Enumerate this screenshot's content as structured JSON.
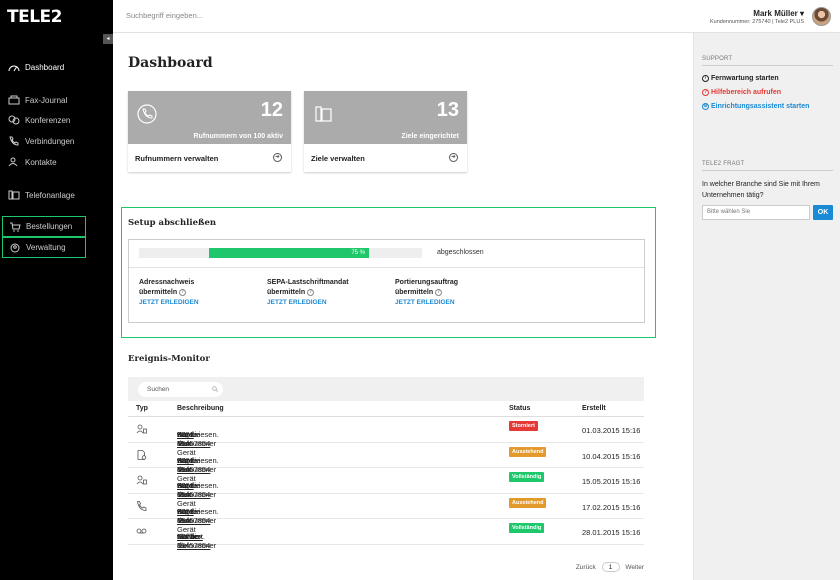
{
  "brand": {
    "logo": "TELE2"
  },
  "search": {
    "placeholder": "Suchbegriff eingeben..."
  },
  "user": {
    "name": "Mark Müller ▾",
    "sub": "Kundennummer: 275740 | Tele2 PLUS"
  },
  "sidebar": {
    "collapse_glyph": "◂",
    "items": [
      {
        "label": "Dashboard",
        "icon": "gauge-icon"
      },
      {
        "label": "Fax-Journal",
        "icon": "fax-icon"
      },
      {
        "label": "Konferenzen",
        "icon": "conference-icon"
      },
      {
        "label": "Verbindungen",
        "icon": "phone-icon"
      },
      {
        "label": "Kontakte",
        "icon": "contacts-icon"
      },
      {
        "label": "Telefonanlage",
        "icon": "phone-system-icon"
      },
      {
        "label": "Bestellungen",
        "icon": "cart-icon"
      },
      {
        "label": "Verwaltung",
        "icon": "admin-icon"
      }
    ]
  },
  "main": {
    "title": "Dashboard",
    "cards": [
      {
        "number": "12",
        "caption": "Rufnummern von 100 aktiv",
        "action": "Rufnummern verwalten",
        "icon": "phone-icon"
      },
      {
        "number": "13",
        "caption": "Ziele eingerichtet",
        "action": "Ziele verwalten",
        "icon": "phone-system-icon"
      }
    ],
    "setup": {
      "title": "Setup abschließen",
      "progress_label": "75 %",
      "progress_value": 75,
      "status": "abgeschlossen",
      "tasks": [
        {
          "line1": "Adressnachweis",
          "line2": "übermitteln",
          "link": "JETZT ERLEDIGEN"
        },
        {
          "line1": "SEPA-Lastschriftmandat",
          "line2": "übermitteln",
          "link": "JETZT ERLEDIGEN"
        },
        {
          "line1": "Portierungsauftrag",
          "line2": "übermitteln",
          "link": "JETZT ERLEDIGEN"
        }
      ]
    },
    "monitor": {
      "title": "Ereignis-Monitor",
      "search_placeholder": "Suchen",
      "columns": {
        "type": "Typ",
        "desc": "Beschreibung",
        "status": "Status",
        "created": "Erstellt"
      },
      "rows": [
        {
          "icon": "user-device-icon",
          "pre": "Für die Rufnummer ",
          "number": "0221 16457854",
          "mid": " wurde dem Gerät ",
          "target": "Büro Max",
          "post": " zugewiesen.",
          "status": "Storniert",
          "status_color": "#e53935",
          "date": "01.03.2015 15:16"
        },
        {
          "icon": "document-icon",
          "pre": "Für die Rufnummer ",
          "number": "0221 16457854",
          "mid": " wurde dem Gerät ",
          "target": "Büro Max",
          "post": " zugewiesen.",
          "status": "Ausstehend",
          "status_color": "#e39a2b",
          "date": "10.04.2015 15:16"
        },
        {
          "icon": "user-device-icon",
          "pre": "Für die Rufnummer ",
          "number": "0221 16457854",
          "mid": " wurde dem Gerät ",
          "target": "Büro Max",
          "post": " zugewiesen.",
          "status": "Vollständig",
          "status_color": "#1ec76b",
          "date": "15.05.2015 15:16"
        },
        {
          "icon": "phone-icon",
          "pre": "Für die Rufnummer ",
          "number": "0221 16457854",
          "mid": " wurde dem Gerät ",
          "target": "Büro Max",
          "post": " zugewiesen.",
          "status": "Ausstehend",
          "status_color": "#e39a2b",
          "date": "17.02.2015 15:16"
        },
        {
          "icon": "voicemail-icon",
          "pre": "Für die Rufnummer ",
          "number": "0221 16457854",
          "mid": " wurde die ",
          "target": "Mailbox",
          "post": " aktiviert.",
          "status": "Vollständig",
          "status_color": "#1ec76b",
          "date": "28.01.2015 15:16"
        }
      ],
      "pager": {
        "prev": "Zurück",
        "page": "1",
        "next": "Weiter"
      }
    }
  },
  "right": {
    "support_heading": "SUPPORT",
    "support_links": [
      {
        "label": "Fernwartung starten",
        "color": "#222222",
        "icon": "remote-icon"
      },
      {
        "label": "Hilfebereich aufrufen",
        "color": "#e53935",
        "icon": "help-icon"
      },
      {
        "label": "Einrichtungsassistent starten",
        "color": "#1a8ad5",
        "icon": "wrench-icon"
      }
    ],
    "ask_heading": "TELE2 FRAGT",
    "question": "In welcher Branche sind Sie mit Ihrem Unternehmen tätig?",
    "select_value": "Bitte wählen Sie",
    "ok": "OK"
  },
  "colors": {
    "accent_green": "#1ec76b",
    "link_blue": "#1a8ad5",
    "sidebar_bg": "#000000",
    "card_gray": "#ababab"
  }
}
